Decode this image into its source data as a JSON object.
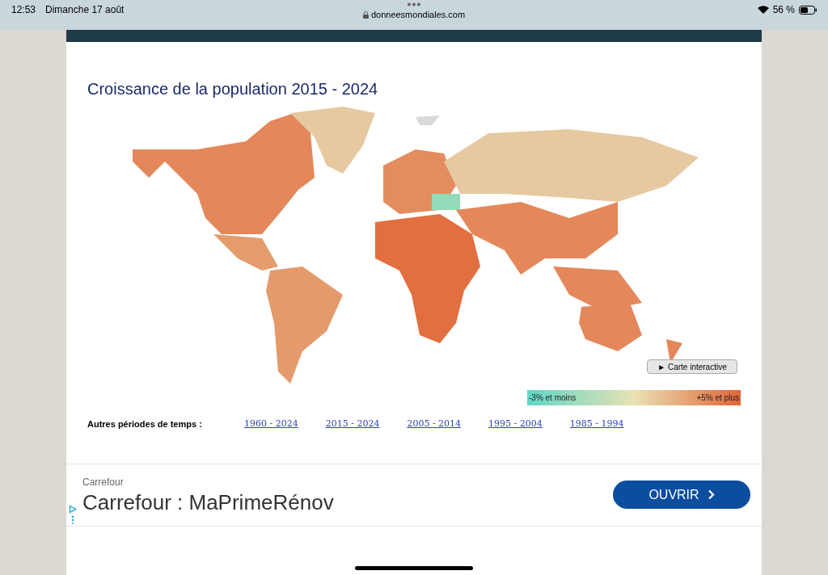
{
  "status_bar": {
    "time": "12:53",
    "date": "Dimanche 17 août",
    "url": "donneesmondiales.com",
    "battery": "56 %"
  },
  "title": "Croissance de la population 2015 - 2024",
  "map_button": "► Carte interactive",
  "legend": {
    "min_label": "-3% et moins",
    "max_label": "+5% et plus"
  },
  "periods": {
    "label": "Autres périodes de temps :",
    "links": [
      "1960 - 2024",
      "2015 - 2024",
      "2005 - 2014",
      "1995 - 2004",
      "1985 - 1994"
    ]
  },
  "ad": {
    "advertiser": "Carrefour",
    "headline": "Carrefour : MaPrimeRénov",
    "button": "OUVRIR"
  }
}
